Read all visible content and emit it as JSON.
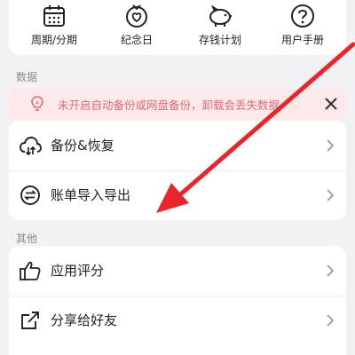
{
  "quick_actions": [
    {
      "label": "周期/分期",
      "icon": "calendar-icon"
    },
    {
      "label": "纪念日",
      "icon": "anniversary-icon"
    },
    {
      "label": "存钱计划",
      "icon": "piggy-bank-icon"
    },
    {
      "label": "用户手册",
      "icon": "help-icon"
    }
  ],
  "sections": {
    "data": {
      "title": "数据",
      "banner": {
        "text": "未开启自动备份或网盘备份，卸载会丢失数据",
        "icon": "lightbulb-icon",
        "close_icon": "close-icon"
      },
      "items": [
        {
          "label": "备份&恢复",
          "icon": "cloud-sync-icon"
        },
        {
          "label": "账单导入导出",
          "icon": "import-export-icon"
        }
      ]
    },
    "other": {
      "title": "其他",
      "items": [
        {
          "label": "应用评分",
          "icon": "thumbs-up-icon"
        },
        {
          "label": "分享给好友",
          "icon": "share-icon"
        }
      ]
    }
  },
  "colors": {
    "background": "#f2f2f4",
    "banner_bg": "#fde9ea",
    "banner_text": "#e26a6f",
    "annotation_arrow": "#e8262b"
  }
}
